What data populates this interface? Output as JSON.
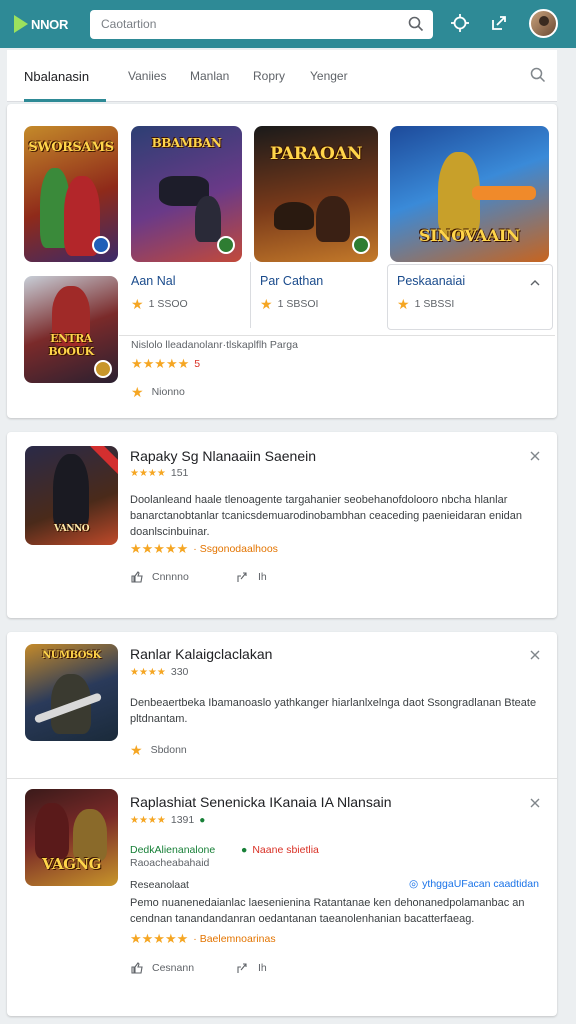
{
  "header": {
    "logo_text": "NNOR",
    "search_placeholder": "Caotartion"
  },
  "tabs": [
    {
      "label": "Nbalanasin",
      "active": true
    },
    {
      "label": "Vaniies",
      "active": false
    },
    {
      "label": "Manlan",
      "active": false
    },
    {
      "label": "Ropry",
      "active": false
    },
    {
      "label": "Yenger",
      "active": false
    }
  ],
  "featured": {
    "thumbs": [
      {
        "art": "SWORSAMS"
      },
      {
        "art": "BBAMBAN"
      },
      {
        "art": "PARAOAN"
      },
      {
        "art": "SINOVAAIN"
      },
      {
        "art": "ENTRA BOOUK"
      }
    ],
    "mini_cards": [
      {
        "title": "Aan Nal",
        "rating": "1 SSOO"
      },
      {
        "title": "Par Cathan",
        "rating": "1 SBSOI"
      },
      {
        "title": "Peskaanaiai",
        "rating": "1 SBSSI"
      }
    ],
    "extra": {
      "text": "Nislolo lleadanolanr·tlskaplflh Parga",
      "stars": "★★★★★",
      "count": "5",
      "action_label": "Nionno"
    }
  },
  "apps": [
    {
      "title": "Rapaky Sg Nlanaaiin Saenein",
      "rating_line": "151",
      "desc": "Doolanleand haale tlenoagente targahanier seobehanofdolooro nbcha hlanlar banarctanobtanlar tcanicsdemuarodinobambhan ceaceding paenieidaran enidan doanlscinbuinar.",
      "stars": "★★★★★",
      "meta": "· Ssgonodaalhoos",
      "action1": "Cnnnno",
      "action2": "Ih"
    },
    {
      "title": "Ranlar Kalaigclaclakan",
      "rating_line": "330",
      "desc": "Denbeaertbeka Ibamanoaslo yathkanger hiarlanlxelnga daot Ssongradlanan Bteate pltdnantam.",
      "action1": "Sbdonn"
    },
    {
      "title": "Raplashiat Senenicka IKanaia IA Nlansain",
      "rating_line": "1391",
      "tag_left_1": "DedkAlienanalone",
      "tag_left_2": "Raoacheabahaid",
      "tag_right": "Naane sbietlia",
      "subhead": "Reseanolaat",
      "link": "ythggaUFacan caadtidan",
      "desc": "Pemo nuanenedaianlac laesenienina Ratantanae ken dehonanedpolamanbac an cendnan tanandandanran oedantanan taeanolenhanian bacatterfaeag.",
      "stars": "★★★★★",
      "meta": "· Baelemnoarinas",
      "action1": "Cesnann",
      "action2": "Ih"
    }
  ],
  "colors": {
    "accent": "#2e8a96",
    "star": "#f5a623",
    "link": "#1a73e8"
  }
}
